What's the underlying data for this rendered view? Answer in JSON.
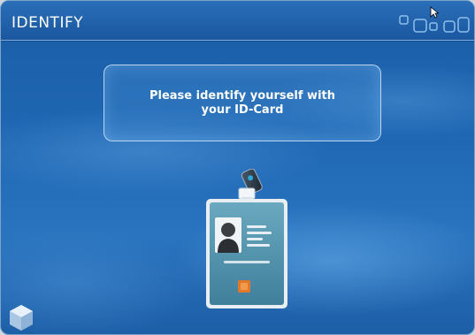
{
  "window": {
    "title": "IDENTIFY",
    "title_decoration_icon": "windows-cluster-icon",
    "corner_logo_icon": "cube-logo-icon"
  },
  "message": {
    "text": "Please identify yourself with\nyour ID-Card"
  },
  "illustration": {
    "icon": "id-card-badge-icon"
  },
  "colors": {
    "background_blue": "#1f67b3",
    "panel_border": "#d2e6fa",
    "card_teal": "#4f93ad",
    "chip_orange": "#e07a2a"
  }
}
